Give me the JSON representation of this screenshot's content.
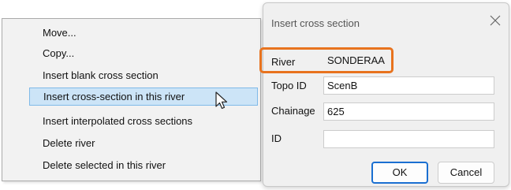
{
  "context_menu": {
    "items": [
      {
        "label": "Move..."
      },
      {
        "label": "Copy..."
      },
      {
        "label": "Insert blank cross section"
      },
      {
        "label": "Insert cross-section in this river",
        "highlighted": true
      },
      {
        "label": "Insert interpolated cross sections"
      },
      {
        "label": "Delete river"
      },
      {
        "label": "Delete selected in this river"
      }
    ]
  },
  "dialog": {
    "title": "Insert cross section",
    "close_icon": "close-icon",
    "fields": {
      "river": {
        "label": "River",
        "value": "SONDERAA"
      },
      "topo_id": {
        "label": "Topo ID",
        "value": "ScenB"
      },
      "chainage": {
        "label": "Chainage",
        "value": "625"
      },
      "id": {
        "label": "ID",
        "value": ""
      }
    },
    "ok_label": "OK",
    "cancel_label": "Cancel"
  },
  "colors": {
    "accent": "#1a6fd1",
    "callout": "#e8731e",
    "menu_highlight": "#cce4f7"
  }
}
